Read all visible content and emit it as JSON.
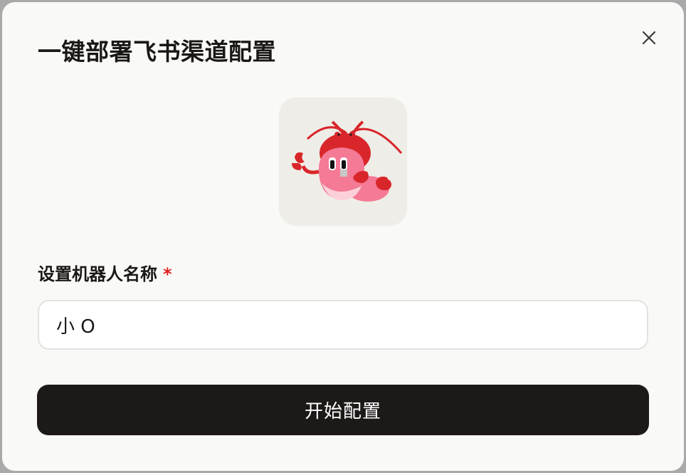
{
  "dialog": {
    "title": "一键部署飞书渠道配置",
    "close_icon": "close-icon",
    "mascot_icon": "lobster-mascot-icon"
  },
  "form": {
    "name_label": "设置机器人名称",
    "required_mark": "*",
    "name_value": "小 O",
    "submit_label": "开始配置"
  },
  "colors": {
    "background": "#f9f9f7",
    "button_bg": "#1d1918",
    "required": "#e02020",
    "mascot_red": "#d8262a",
    "mascot_pink": "#f47a95"
  }
}
